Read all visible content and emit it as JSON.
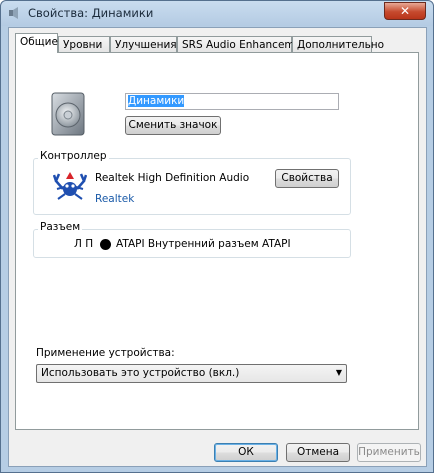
{
  "window": {
    "title": "Свойства: Динамики",
    "close_label": "✕"
  },
  "tabs": [
    "Общие",
    "Уровни",
    "Улучшения",
    "SRS Audio Enhancement",
    "Дополнительно"
  ],
  "general": {
    "device_name": "Динамики",
    "change_icon_label": "Сменить значок",
    "controller": {
      "group_label": "Контроллер",
      "name": "Realtek High Definition Audio",
      "properties_label": "Свойства",
      "vendor_link": "Realtek"
    },
    "jack": {
      "group_label": "Разъем",
      "channels": "Л П",
      "description": "ATAPI Внутренний разъем ATAPI"
    },
    "usage": {
      "label": "Применение устройства:",
      "selected": "Использовать это устройство (вкл.)"
    }
  },
  "buttons": {
    "ok": "ОК",
    "cancel": "Отмена",
    "apply": "Применить"
  }
}
